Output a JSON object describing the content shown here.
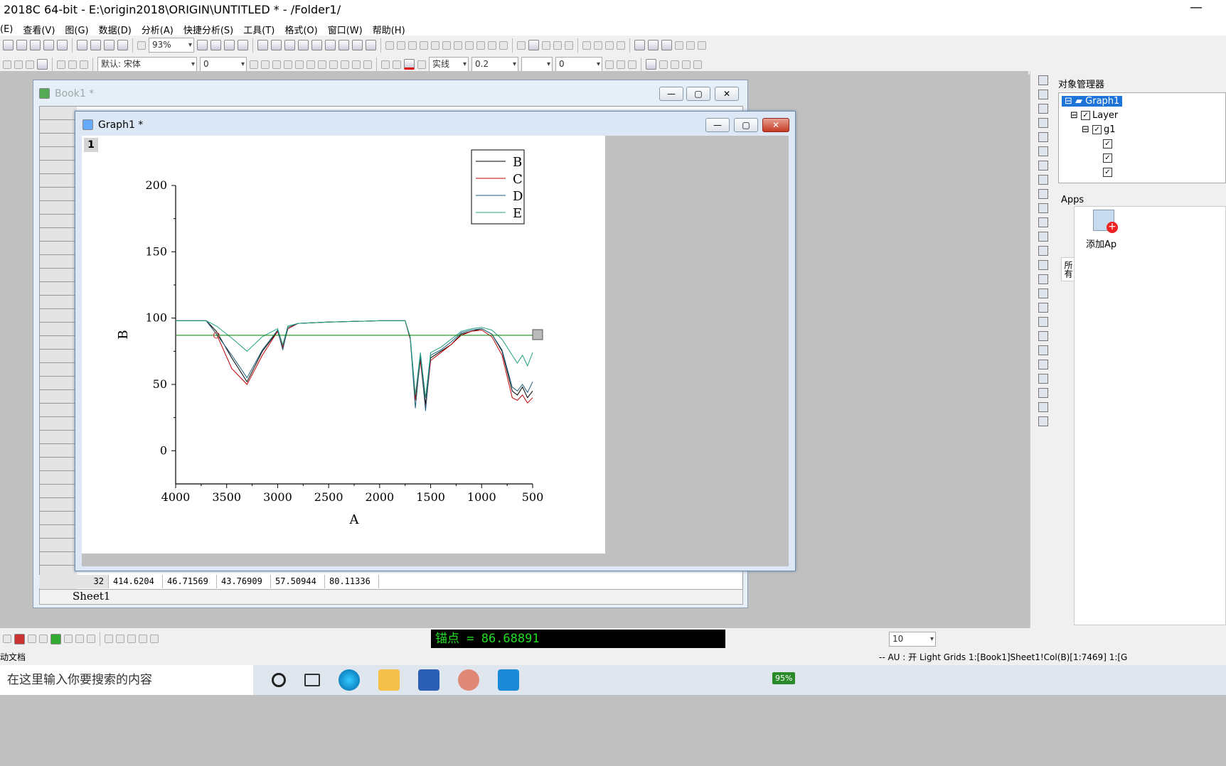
{
  "window": {
    "title": "2018C 64-bit - E:\\origin2018\\ORIGIN\\UNTITLED * - /Folder1/",
    "minimize": "—"
  },
  "menu": [
    "(E)",
    "查看(V)",
    "图(G)",
    "数据(D)",
    "分析(A)",
    "快捷分析(S)",
    "工具(T)",
    "格式(O)",
    "窗口(W)",
    "帮助(H)"
  ],
  "toolbar": {
    "zoom": "93%",
    "font": "默认: 宋体",
    "font_size": "0",
    "line_style": "实线",
    "line_width": "0.2",
    "value": "0"
  },
  "book": {
    "title": "Book1 *",
    "row": {
      "index": "32",
      "cells": [
        "414.6204",
        "46.71569",
        "43.76909",
        "57.50944",
        "80.11336"
      ]
    },
    "sheet_tab": "Sheet1"
  },
  "graph_window": {
    "title": "Graph1 *",
    "layer": "1"
  },
  "chart_data": {
    "type": "line",
    "xlabel": "A",
    "ylabel": "B",
    "xlim": [
      4000,
      500
    ],
    "ylim": [
      -25,
      200
    ],
    "xticks": [
      "4000",
      "3500",
      "3000",
      "2500",
      "2000",
      "1500",
      "1000",
      "500"
    ],
    "yticks": [
      "0",
      "50",
      "100",
      "150",
      "200"
    ],
    "legend_position": "top-right",
    "baseline": {
      "y": 87,
      "color": "#008000"
    },
    "series": [
      {
        "name": "B",
        "color": "#000000",
        "x": [
          4000,
          3700,
          3600,
          3450,
          3300,
          3150,
          3000,
          2950,
          2900,
          2800,
          2500,
          2000,
          1750,
          1700,
          1650,
          1600,
          1550,
          1500,
          1400,
          1300,
          1200,
          1100,
          1000,
          900,
          800,
          700,
          650,
          600,
          550,
          500
        ],
        "y": [
          98,
          98,
          90,
          70,
          52,
          75,
          90,
          78,
          92,
          96,
          97,
          98,
          98,
          85,
          40,
          70,
          35,
          70,
          75,
          80,
          88,
          90,
          92,
          88,
          75,
          45,
          42,
          48,
          40,
          45
        ]
      },
      {
        "name": "C",
        "color": "#c00000",
        "x": [
          4000,
          3700,
          3600,
          3450,
          3300,
          3150,
          3000,
          2950,
          2900,
          2800,
          2500,
          2000,
          1750,
          1700,
          1650,
          1600,
          1550,
          1500,
          1400,
          1300,
          1200,
          1100,
          1000,
          900,
          800,
          700,
          650,
          600,
          550,
          500
        ],
        "y": [
          98,
          98,
          88,
          62,
          50,
          72,
          90,
          78,
          92,
          96,
          97,
          98,
          98,
          84,
          38,
          68,
          32,
          68,
          74,
          80,
          87,
          90,
          91,
          86,
          72,
          40,
          38,
          42,
          36,
          40
        ]
      },
      {
        "name": "D",
        "color": "#1f5f7f",
        "x": [
          4000,
          3700,
          3600,
          3450,
          3300,
          3150,
          3000,
          2950,
          2900,
          2800,
          2500,
          2000,
          1750,
          1700,
          1650,
          1600,
          1550,
          1500,
          1400,
          1300,
          1200,
          1100,
          1000,
          900,
          800,
          700,
          650,
          600,
          550,
          500
        ],
        "y": [
          98,
          98,
          88,
          72,
          55,
          76,
          91,
          76,
          93,
          96,
          97,
          98,
          98,
          85,
          32,
          72,
          30,
          72,
          76,
          82,
          89,
          91,
          92,
          88,
          76,
          48,
          45,
          50,
          44,
          52
        ]
      },
      {
        "name": "E",
        "color": "#20a080",
        "x": [
          4000,
          3700,
          3600,
          3450,
          3300,
          3150,
          3000,
          2950,
          2900,
          2800,
          2500,
          2000,
          1750,
          1700,
          1650,
          1600,
          1550,
          1500,
          1400,
          1300,
          1200,
          1100,
          1000,
          900,
          800,
          700,
          650,
          600,
          550,
          500
        ],
        "y": [
          98,
          98,
          94,
          85,
          75,
          86,
          92,
          80,
          94,
          96,
          97,
          98,
          98,
          86,
          42,
          74,
          40,
          74,
          78,
          84,
          90,
          92,
          93,
          91,
          84,
          72,
          66,
          72,
          64,
          74
        ]
      }
    ]
  },
  "object_manager": {
    "title": "对象管理器",
    "items": [
      "Graph1",
      "Layer",
      "g1"
    ]
  },
  "apps": {
    "title": "Apps",
    "add_label": "添加Ap",
    "tab": "所有"
  },
  "anchor_readout": "锚点 = 86.68891",
  "bottom_combo": "10",
  "status": {
    "left": "动文档",
    "right": "--   AU : 开  Light Grids  1:[Book1]Sheet1!Col(B)[1:7469]  1:[G"
  },
  "taskbar": {
    "search_placeholder": "在这里输入你要搜索的内容",
    "battery": "95%"
  }
}
